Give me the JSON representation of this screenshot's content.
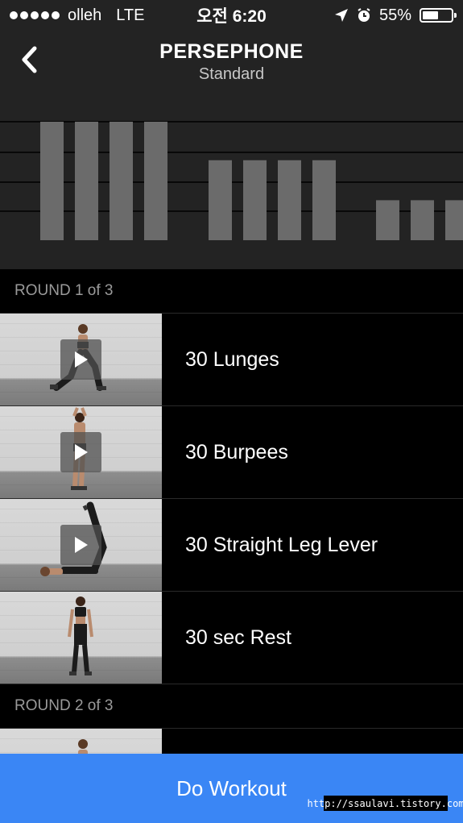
{
  "status_bar": {
    "carrier": "olleh",
    "network": "LTE",
    "time": "오전 6:20",
    "battery_percent": "55%",
    "battery_level": 0.55
  },
  "header": {
    "back_icon": "chevron-left-icon",
    "title": "PERSEPHONE",
    "subtitle": "Standard"
  },
  "chart_data": {
    "type": "bar",
    "title": "",
    "xlabel": "",
    "ylabel": "",
    "grid": true,
    "bar_color": "#6b6b6b",
    "gridline_color": "#000000",
    "ylim": [
      0,
      4
    ],
    "values": [
      4,
      4,
      4,
      4,
      2.7,
      2.7,
      2.7,
      2.7,
      1.35,
      1.35,
      1.35
    ]
  },
  "rounds": [
    {
      "label": "ROUND 1 of 3",
      "exercises": [
        {
          "name": "30 Lunges",
          "has_video": true,
          "pose": "lunge"
        },
        {
          "name": "30 Burpees",
          "has_video": true,
          "pose": "stretch"
        },
        {
          "name": "30 Straight Leg Lever",
          "has_video": true,
          "pose": "lying"
        },
        {
          "name": "30 sec Rest",
          "has_video": false,
          "pose": "stand"
        }
      ]
    },
    {
      "label": "ROUND 2 of 3",
      "exercises": []
    }
  ],
  "actions": {
    "do_workout_label": "Do Workout"
  },
  "watermark": "http://ssaulavi.tistory.com",
  "colors": {
    "accent": "#3a86f5",
    "header_bg": "#232323",
    "list_bg": "#000000"
  }
}
